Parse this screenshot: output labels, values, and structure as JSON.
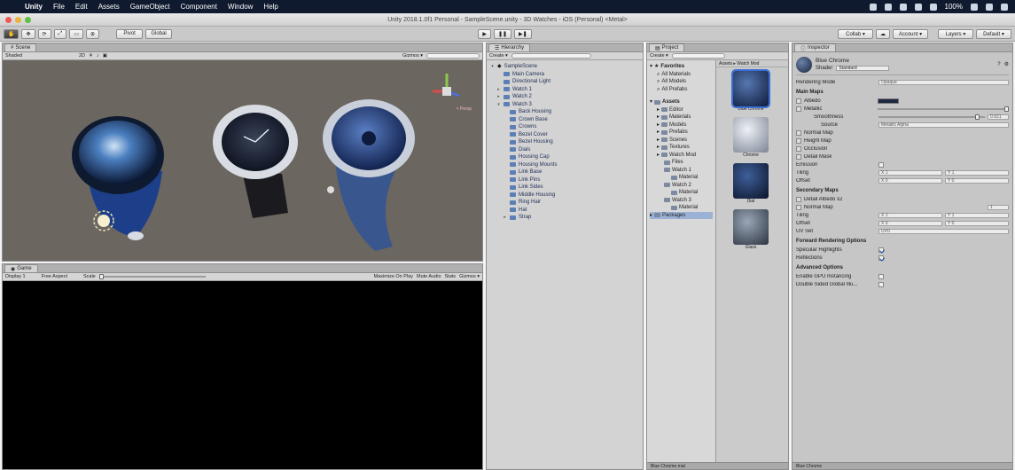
{
  "menubar": {
    "app": "Unity",
    "items": [
      "File",
      "Edit",
      "Assets",
      "GameObject",
      "Component",
      "Window",
      "Help"
    ],
    "battery": "100%",
    "time": ""
  },
  "window": {
    "title": "Unity 2018.1.0f1 Personal - SampleScene.unity - 3D Watches - iOS (Personal) <Metal>"
  },
  "toolbar": {
    "pivot": "Pivot",
    "global": "Global",
    "play_controls": [
      "▶",
      "❚❚",
      "▶❚"
    ],
    "collab": "Collab ▾",
    "account": "Account ▾",
    "layers": "Layers ▾",
    "layout": "Default ▾"
  },
  "scene": {
    "tab": "Scene",
    "shading": "Shaded",
    "mode": "2D",
    "gizmos": "Gizmos ▾",
    "search_placeholder": "All",
    "persp_label": "< Persp"
  },
  "game": {
    "tab": "Game",
    "display": "Display 1",
    "aspect": "Free Aspect",
    "scale": "Scale",
    "maximize": "Maximize On Play",
    "mute": "Mute Audio",
    "stats": "Stats",
    "gizmos": "Gizmos ▾"
  },
  "hierarchy": {
    "tab": "Hierarchy",
    "create": "Create ▾",
    "search_placeholder": "All",
    "scene": "SampleScene",
    "items": [
      {
        "label": "Main Camera",
        "indent": 2
      },
      {
        "label": "Directional Light",
        "indent": 2
      },
      {
        "label": "Watch 1",
        "indent": 2,
        "arrow": "▸"
      },
      {
        "label": "Watch 2",
        "indent": 2,
        "arrow": "▸"
      },
      {
        "label": "Watch 3",
        "indent": 2,
        "arrow": "▾"
      },
      {
        "label": "Back Housing",
        "indent": 3
      },
      {
        "label": "Crown Base",
        "indent": 3
      },
      {
        "label": "Crowns",
        "indent": 3
      },
      {
        "label": "Bezel Cover",
        "indent": 3
      },
      {
        "label": "Bezel Housing",
        "indent": 3
      },
      {
        "label": "Dials",
        "indent": 3
      },
      {
        "label": "Housing Cap",
        "indent": 3
      },
      {
        "label": "Housing Mounts",
        "indent": 3
      },
      {
        "label": "Link Base",
        "indent": 3
      },
      {
        "label": "Link Pins",
        "indent": 3
      },
      {
        "label": "Link Sides",
        "indent": 3
      },
      {
        "label": "Middle Housing",
        "indent": 3
      },
      {
        "label": "Ring Hair",
        "indent": 3
      },
      {
        "label": "Hat",
        "indent": 3
      },
      {
        "label": "Strap",
        "indent": 3,
        "arrow": "▸"
      }
    ]
  },
  "project": {
    "tab": "Project",
    "create": "Create ▾",
    "breadcrumb": "Assets ▸ Watch Mod",
    "favorites": {
      "label": "Favorites",
      "items": [
        "All Materials",
        "All Models",
        "All Prefabs"
      ]
    },
    "assets": {
      "label": "Assets",
      "items": [
        "Editor",
        "Materials",
        "Models",
        "Prefabs",
        "Scenes",
        "Textures",
        "Watch Mod"
      ]
    },
    "submodel": {
      "items": [
        "Files",
        "Watch 1",
        "Material",
        "Watch 2",
        "Material",
        "Watch 3",
        "Material"
      ]
    },
    "packages": "Packages",
    "tiles": [
      {
        "label": "Blue Chrome",
        "color1": "#5677b0",
        "color2": "#0d1a3a"
      },
      {
        "label": "Chrome",
        "color1": "#eef1f6",
        "color2": "#7c8594"
      },
      {
        "label": "Dial",
        "color1": "#3e5f9a",
        "color2": "#0a1428"
      },
      {
        "label": "Glass",
        "color1": "#9aa7b8",
        "color2": "#2c3440"
      }
    ],
    "status": "Blue Chrome.mat"
  },
  "inspector": {
    "tab": "Inspector",
    "material_name": "Blue Chrome",
    "shader_label": "Shader",
    "shader_value": "Standard",
    "rendering_mode_label": "Rendering Mode",
    "rendering_mode_value": "Opaque",
    "main_maps": "Main Maps",
    "albedo": "Albedo",
    "metallic": "Metallic",
    "smoothness": "Smoothness",
    "smoothness_value": "0.921",
    "source": "Source",
    "source_value": "Metallic Alpha",
    "normal_map": "Normal Map",
    "height_map": "Height Map",
    "occlusion": "Occlusion",
    "detail_mask": "Detail Mask",
    "emission": "Emission",
    "tiling": "Tiling",
    "offset": "Offset",
    "x_val": "X 1",
    "y_val": "Y 1",
    "x_off": "X 0",
    "y_off": "Y 0",
    "secondary_maps": "Secondary Maps",
    "detail_albedo": "Detail Albedo x2",
    "sec_normal": "Normal Map",
    "sec_normal_value": "1",
    "uv_set": "UV Set",
    "uv_set_value": "UV0",
    "forward_opts": "Forward Rendering Options",
    "specular_highlights": "Specular Highlights",
    "reflections": "Reflections",
    "advanced": "Advanced Options",
    "gpu_instancing": "Enable GPU Instancing",
    "double_sided": "Double Sided Global Illu...",
    "bottom": "Blue Chrome"
  }
}
